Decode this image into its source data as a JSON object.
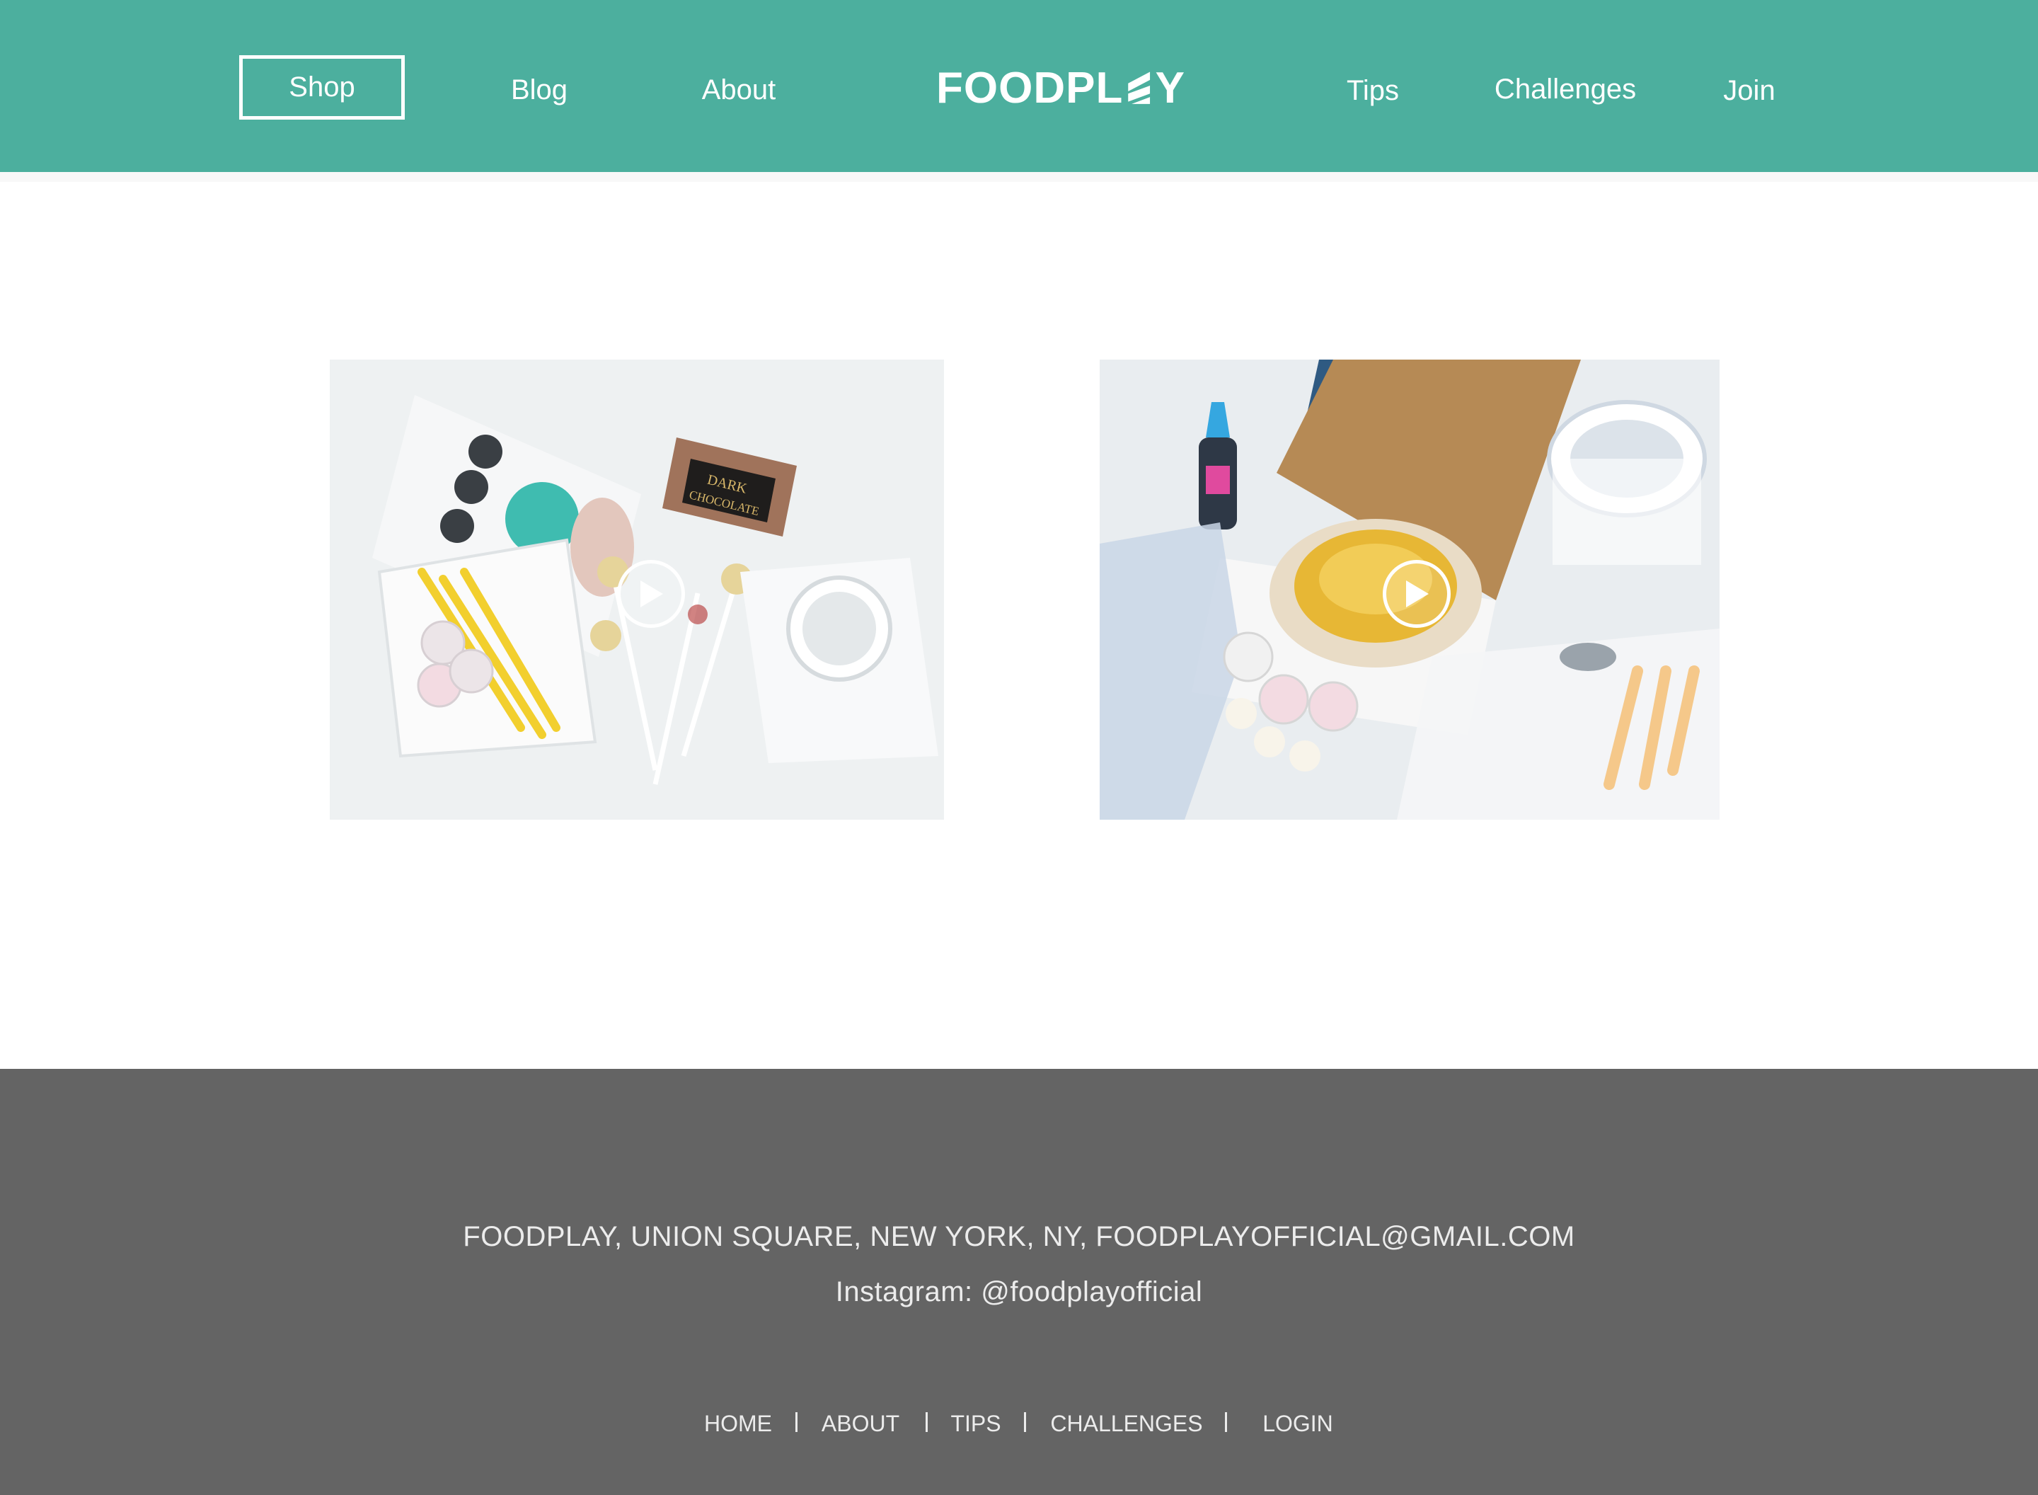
{
  "header": {
    "logo_text_left": "FOODPL",
    "logo_text_right": "Y",
    "nav": {
      "shop": "Shop",
      "blog": "Blog",
      "about": "About",
      "tips": "Tips",
      "challenges": "Challenges",
      "join": "Join"
    },
    "colors": {
      "background": "#4caf9e",
      "text": "#ffffff"
    }
  },
  "gallery": {
    "videos": [
      {
        "subject": "cake pop kit with dark chocolate bar",
        "play_icon": "play-icon"
      },
      {
        "subject": "cake in box with piping supplies",
        "play_icon": "play-icon"
      }
    ],
    "chocolate_label": [
      "DARK",
      "CHOCOLATE"
    ]
  },
  "footer": {
    "address": "FOODPLAY, UNION SQUARE, NEW YORK, NY, FOODPLAYOFFICIAL@GMAIL.COM",
    "instagram": "Instagram: @foodplayofficial",
    "nav": [
      "HOME",
      "ABOUT",
      "TIPS",
      "CHALLENGES",
      "LOGIN"
    ],
    "colors": {
      "background": "#646464",
      "text": "#ececec"
    }
  }
}
